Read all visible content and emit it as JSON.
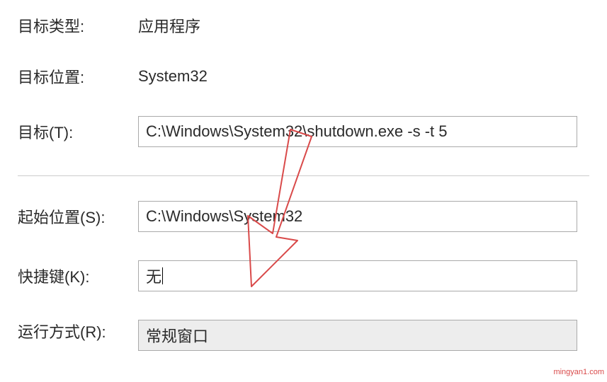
{
  "labels": {
    "target_type": "目标类型:",
    "target_location": "目标位置:",
    "target": "目标(T):",
    "start_in": "起始位置(S):",
    "shortcut_key": "快捷键(K):",
    "run": "运行方式(R):"
  },
  "values": {
    "target_type": "应用程序",
    "target_location": "System32",
    "target": "C:\\Windows\\System32\\shutdown.exe -s -t 5",
    "start_in": "C:\\Windows\\System32",
    "shortcut_key": "无",
    "run": "常规窗口"
  },
  "watermark": "mingyan1.com",
  "colors": {
    "annotation": "#d94a4a"
  }
}
